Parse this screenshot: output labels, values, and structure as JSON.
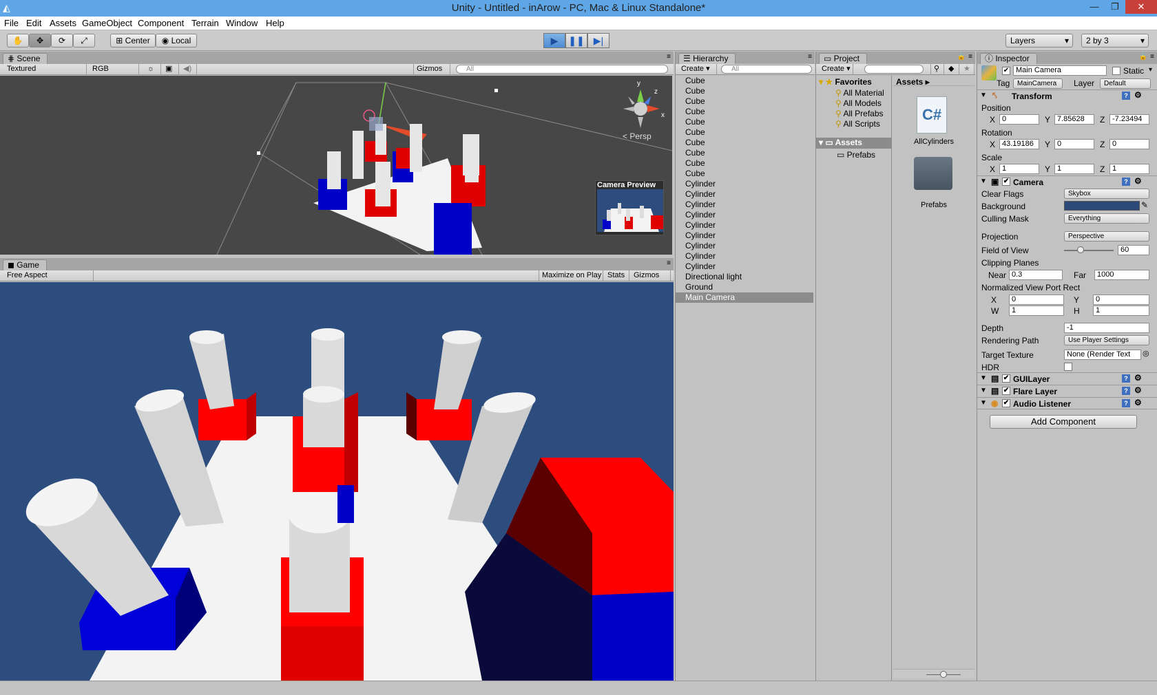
{
  "window": {
    "title": "Unity - Untitled - inArow - PC, Mac & Linux Standalone*"
  },
  "menu": [
    "File",
    "Edit",
    "Assets",
    "GameObject",
    "Component",
    "Terrain",
    "Window",
    "Help"
  ],
  "toolbar": {
    "center": "Center",
    "local": "Local",
    "layers": "Layers",
    "layout": "2 by 3"
  },
  "scene": {
    "tab": "Scene",
    "render_mode": "Textured",
    "channel": "RGB",
    "gizmos": "Gizmos",
    "search_placeholder": "All",
    "persp": "Persp",
    "camera_preview": "Camera Preview"
  },
  "game": {
    "tab": "Game",
    "aspect": "Free Aspect",
    "maximize": "Maximize on Play",
    "stats": "Stats",
    "gizmos": "Gizmos"
  },
  "hierarchy": {
    "tab": "Hierarchy",
    "create": "Create",
    "search_placeholder": "All",
    "items": [
      "Cube",
      "Cube",
      "Cube",
      "Cube",
      "Cube",
      "Cube",
      "Cube",
      "Cube",
      "Cube",
      "Cube",
      "Cylinder",
      "Cylinder",
      "Cylinder",
      "Cylinder",
      "Cylinder",
      "Cylinder",
      "Cylinder",
      "Cylinder",
      "Cylinder",
      "Directional light",
      "Ground",
      "Main Camera"
    ],
    "selected_index": 21
  },
  "project": {
    "tab": "Project",
    "create": "Create",
    "favorites": "Favorites",
    "fav_items": [
      "All Material",
      "All Models",
      "All Prefabs",
      "All Scripts"
    ],
    "assets_label": "Assets",
    "assets_child": "Prefabs",
    "breadcrumb": "Assets",
    "files": [
      {
        "name": "AllCylinders",
        "icon": "csharp-script-icon"
      },
      {
        "name": "Prefabs",
        "icon": "folder-icon"
      }
    ]
  },
  "inspector": {
    "tab": "Inspector",
    "object_name": "Main Camera",
    "static_label": "Static",
    "tag_label": "Tag",
    "tag_value": "MainCamera",
    "layer_label": "Layer",
    "layer_value": "Default",
    "transform": {
      "title": "Transform",
      "position_label": "Position",
      "position": [
        "0",
        "7.85628",
        "-7.23494"
      ],
      "rotation_label": "Rotation",
      "rotation": [
        "43.19186",
        "0",
        "0"
      ],
      "scale_label": "Scale",
      "scale": [
        "1",
        "1",
        "1"
      ]
    },
    "camera": {
      "title": "Camera",
      "clear_flags_label": "Clear Flags",
      "clear_flags": "Skybox",
      "background_label": "Background",
      "background_color": "#2c4a78",
      "culling_mask_label": "Culling Mask",
      "culling_mask": "Everything",
      "projection_label": "Projection",
      "projection": "Perspective",
      "fov_label": "Field of View",
      "fov": "60",
      "fov_fraction": 0.33,
      "clipping_label": "Clipping Planes",
      "near_label": "Near",
      "near": "0.3",
      "far_label": "Far",
      "far": "1000",
      "viewport_label": "Normalized View Port Rect",
      "vp_x": "0",
      "vp_y": "0",
      "vp_w": "1",
      "vp_h": "1",
      "depth_label": "Depth",
      "depth": "-1",
      "rendering_path_label": "Rendering Path",
      "rendering_path": "Use Player Settings",
      "target_texture_label": "Target Texture",
      "target_texture": "None (Render Text",
      "hdr_label": "HDR"
    },
    "components": [
      "GUILayer",
      "Flare Layer",
      "Audio Listener"
    ],
    "add_component": "Add Component"
  },
  "colors": {
    "game_sky": "#2e4d7f",
    "red": "#ff0000",
    "blue": "#0000e0",
    "scene_bg": "#474747",
    "selected_row": "#8c8c8c"
  }
}
